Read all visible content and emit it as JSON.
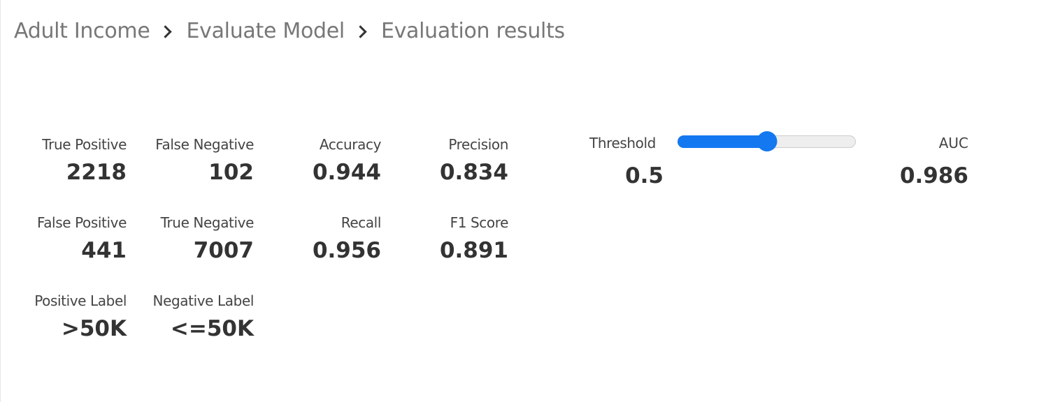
{
  "breadcrumb": {
    "items": [
      "Adult Income",
      "Evaluate Model",
      "Evaluation results"
    ],
    "separator_icon": "chevron-right-icon"
  },
  "confusion_matrix": {
    "true_positive": {
      "label": "True Positive",
      "value": "2218"
    },
    "false_negative": {
      "label": "False Negative",
      "value": "102"
    },
    "false_positive": {
      "label": "False Positive",
      "value": "441"
    },
    "true_negative": {
      "label": "True Negative",
      "value": "7007"
    },
    "positive_label": {
      "label": "Positive Label",
      "value": ">50K"
    },
    "negative_label": {
      "label": "Negative Label",
      "value": "<=50K"
    }
  },
  "metrics": {
    "accuracy": {
      "label": "Accuracy",
      "value": "0.944"
    },
    "precision": {
      "label": "Precision",
      "value": "0.834"
    },
    "recall": {
      "label": "Recall",
      "value": "0.956"
    },
    "f1_score": {
      "label": "F1 Score",
      "value": "0.891"
    }
  },
  "threshold": {
    "label": "Threshold",
    "value": "0.5",
    "slider_fraction": 0.5,
    "accent_color": "#1478f0",
    "track_color": "#eeeeee"
  },
  "auc": {
    "label": "AUC",
    "value": "0.986"
  }
}
